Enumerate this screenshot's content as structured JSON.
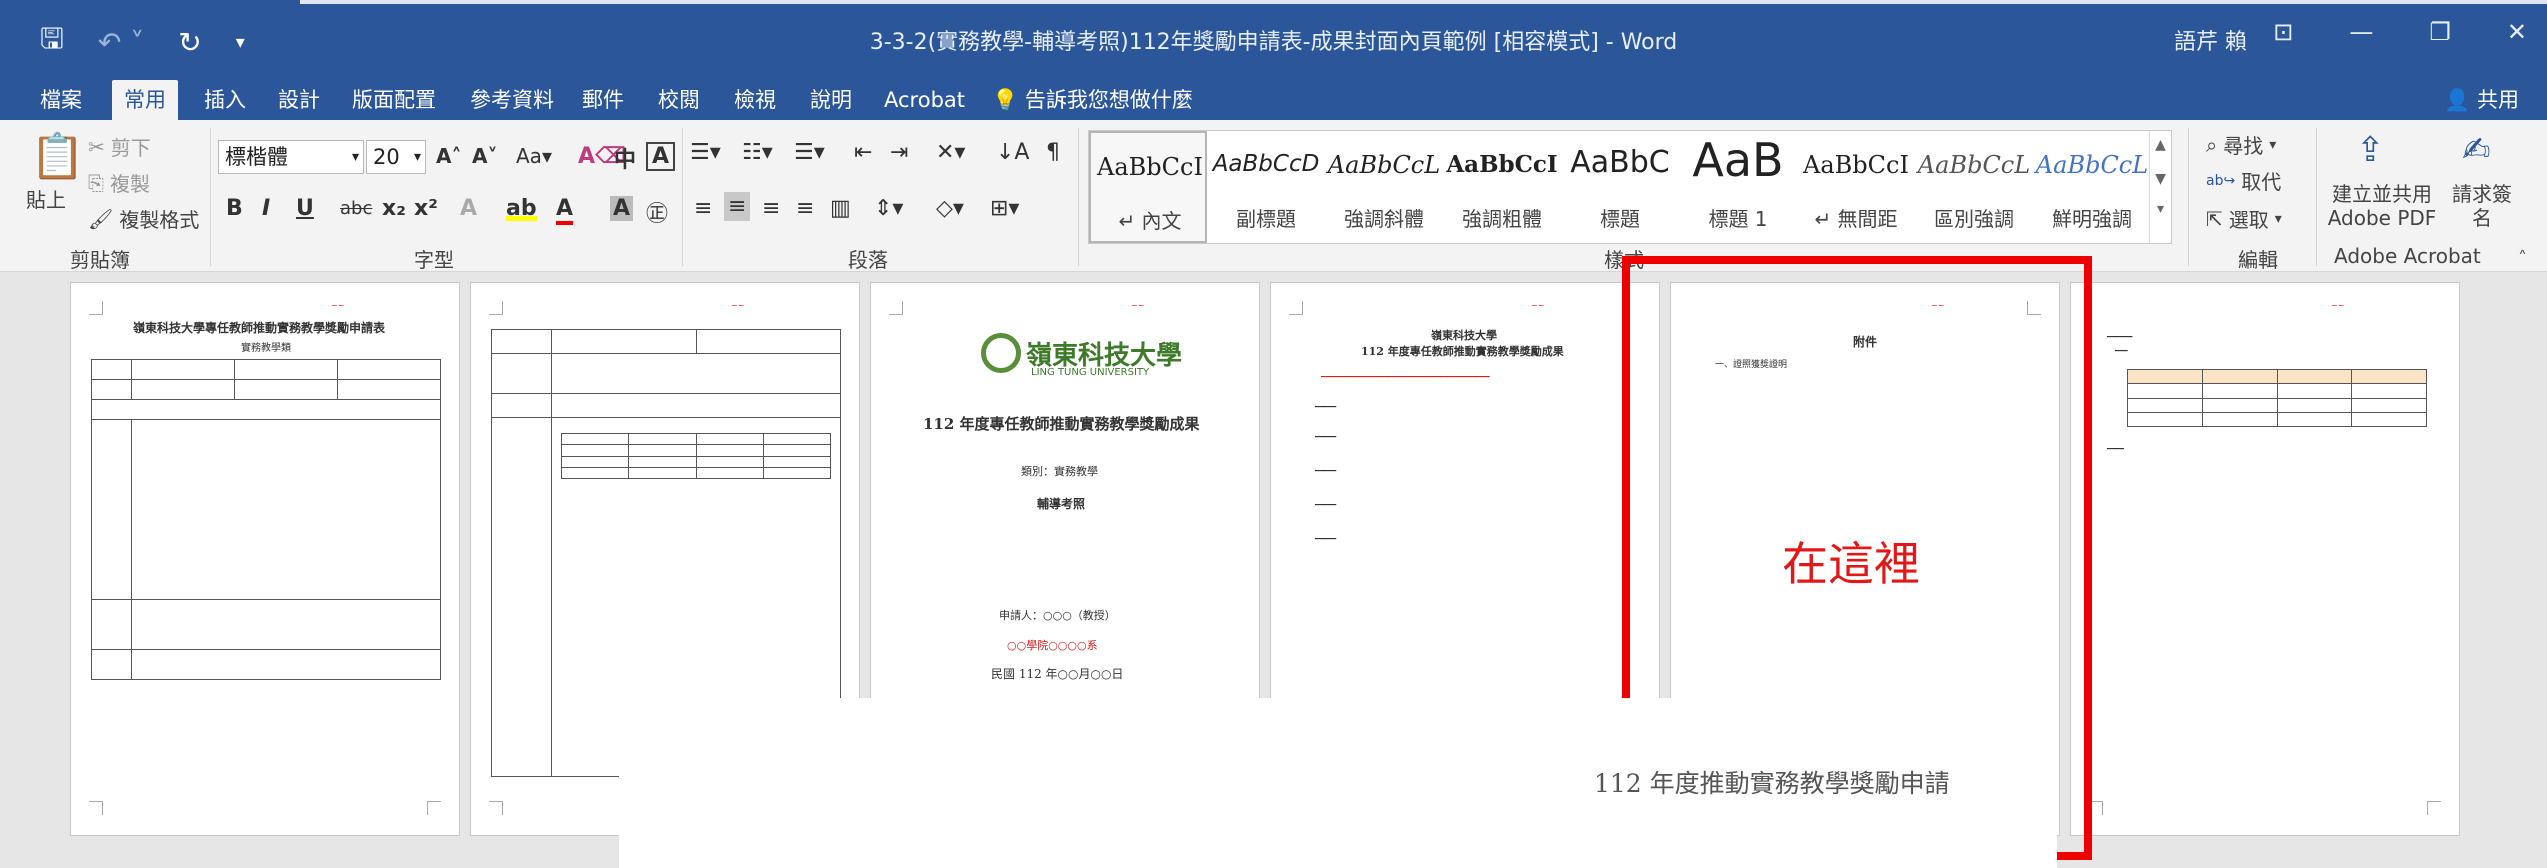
{
  "window": {
    "title": "3-3-2(實務教學-輔導考照)112年獎勵申請表-成果封面內頁範例 [相容模式] - Word",
    "user": "語芹 賴"
  },
  "tabs": [
    "檔案",
    "常用",
    "插入",
    "設計",
    "版面配置",
    "參考資料",
    "郵件",
    "校閱",
    "檢視",
    "說明",
    "Acrobat"
  ],
  "tell_me": "告訴我您想做什麼",
  "share": "共用",
  "clipboard": {
    "paste": "貼上",
    "cut": "剪下",
    "copy": "複製",
    "format_painter": "複製格式",
    "label": "剪貼簿"
  },
  "font": {
    "name": "標楷體",
    "size": "20",
    "label": "字型"
  },
  "paragraph": {
    "label": "段落"
  },
  "styles": {
    "label": "樣式",
    "items": [
      {
        "sample": "AaBbCcI",
        "name": "↵ 內文"
      },
      {
        "sample": "AaBbCcD",
        "name": "副標題"
      },
      {
        "sample": "AaBbCcL",
        "name": "強調斜體"
      },
      {
        "sample": "AaBbCcI",
        "name": "強調粗體"
      },
      {
        "sample": "AaBbC",
        "name": "標題"
      },
      {
        "sample": "AaB",
        "name": "標題 1"
      },
      {
        "sample": "AaBbCcI",
        "name": "↵ 無間距"
      },
      {
        "sample": "AaBbCcL",
        "name": "區別強調"
      },
      {
        "sample": "AaBbCcL",
        "name": "鮮明強調"
      }
    ]
  },
  "editing": {
    "find": "尋找",
    "replace": "取代",
    "select": "選取",
    "label": "編輯"
  },
  "adobe": {
    "create_pdf": "建立並共用 Adobe PDF",
    "request_sign": "請求簽名",
    "label": "Adobe Acrobat"
  },
  "pages": {
    "p1_title": "嶺東科技大學專任教師推動實務教學獎勵申請表",
    "p1_sub": "實務教學類",
    "p3_logo": "嶺東科技大學",
    "p3_logo_en": "LING TUNG UNIVERSITY",
    "p3_title": "112 年度專任教師推動實務教學獎勵成果",
    "p3_cat": "類別：實務教學",
    "p3_sub": "輔導考照",
    "p3_applicant": "申請人：○○○（教授）",
    "p3_dept": "○○學院○○○○系",
    "p3_date": "民國 112 年○○月○○日",
    "p4_school": "嶺東科技大學",
    "p4_title": "112 年度專任教師推動實務教學獎勵成果",
    "p5_heading": "附件",
    "p5_item": "一、證照獲獎證明"
  },
  "annotation": {
    "here": "在這裡",
    "overlay_title": "112 年度推動實務教學獎勵申請"
  }
}
